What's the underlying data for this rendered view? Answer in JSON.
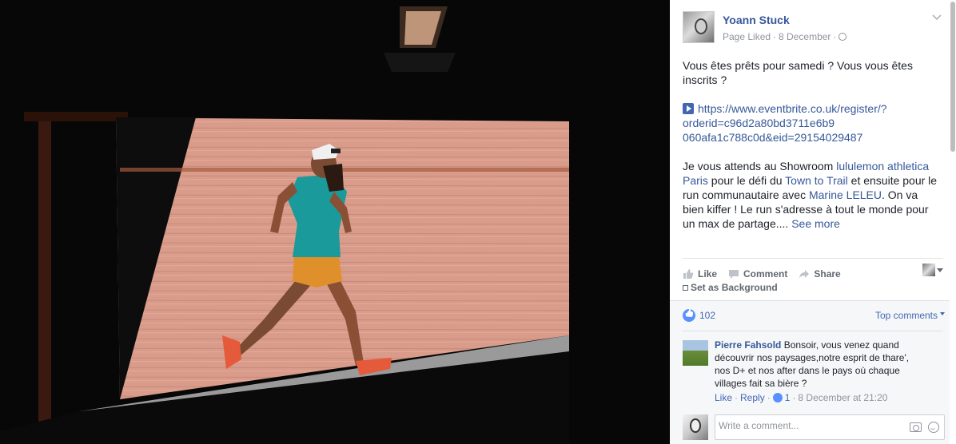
{
  "post": {
    "author": "Yoann Stuck",
    "meta_prefix": "Page Liked",
    "date": "8 December",
    "text_intro": "Vous êtes prêts pour samedi ? Vous vous êtes inscrits ?",
    "link_line1": "https://www.eventbrite.co.uk/register/?",
    "link_line2": "orderid=c96d2a80bd3711e6b9",
    "link_line3": "060afa1c788c0d&eid=29154029487",
    "para_part1": "Je vous attends au Showroom ",
    "para_link1": "lululemon athletica Paris",
    "para_part2": " pour le défi du ",
    "para_link2": "Town to Trail",
    "para_part3": " et ensuite pour le run communautaire avec ",
    "para_link3": "Marine LELEU",
    "para_part4": ". On va bien kiffer ! Le run s'adresse à tout le monde pour un max de partage.... ",
    "see_more": "See more"
  },
  "actions": {
    "like": "Like",
    "comment": "Comment",
    "share": "Share",
    "set_background": "Set as Background"
  },
  "reactions": {
    "count": "102",
    "sort_label": "Top comments"
  },
  "comment": {
    "author": "Pierre Fahsold",
    "text": "Bonsoir, vous venez quand découvrir nos paysages,notre esprit de thare', nos D+ et nos after dans le pays où chaque villages fait sa bière ?",
    "like": "Like",
    "reply": "Reply",
    "like_count": "1",
    "timestamp": "8 December at 21:20"
  },
  "composer": {
    "placeholder": "Write a comment..."
  },
  "colors": {
    "link_blue": "#365899",
    "accent_blue": "#4267b2",
    "wall": "#d99b8a",
    "shadow": "#050505"
  }
}
